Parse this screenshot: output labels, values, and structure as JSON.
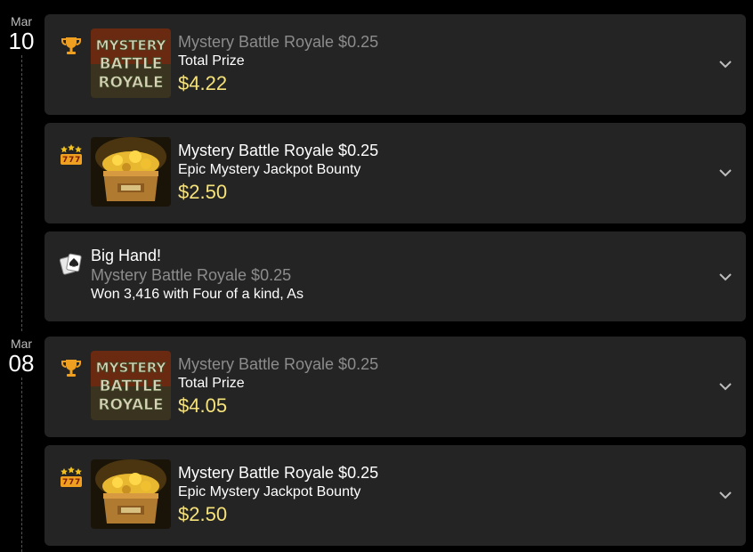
{
  "dates": [
    {
      "month": "Mar",
      "day": "10"
    },
    {
      "month": "Mar",
      "day": "08"
    }
  ],
  "cards": [
    {
      "type": "tournament",
      "icon": "trophy-icon",
      "thumb": "mystery-battle-royale-logo",
      "title": "Mystery Battle Royale $0.25",
      "subtitle": "Total Prize",
      "amount": "$4.22",
      "logo_text": [
        "MYSTERY",
        "BATTLE",
        "ROYALE"
      ]
    },
    {
      "type": "jackpot",
      "icon": "slot-777-icon",
      "thumb": "gold-treasure-chest",
      "title": "Mystery Battle Royale $0.25",
      "subtitle": "Epic Mystery Jackpot Bounty",
      "amount": "$2.50"
    },
    {
      "type": "bighand",
      "icon": "playing-cards-icon",
      "title": "Big Hand!",
      "subtitle": "Mystery Battle Royale $0.25",
      "detail": "Won 3,416 with Four of a kind, As"
    },
    {
      "type": "tournament",
      "icon": "trophy-icon",
      "thumb": "mystery-battle-royale-logo",
      "title": "Mystery Battle Royale $0.25",
      "subtitle": "Total Prize",
      "amount": "$4.05",
      "logo_text": [
        "MYSTERY",
        "BATTLE",
        "ROYALE"
      ]
    },
    {
      "type": "jackpot",
      "icon": "slot-777-icon",
      "thumb": "gold-treasure-chest",
      "title": "Mystery Battle Royale $0.25",
      "subtitle": "Epic Mystery Jackpot Bounty",
      "amount": "$2.50"
    }
  ],
  "colors": {
    "background": "#000000",
    "card": "#242424",
    "muted_text": "#8c8c8c",
    "amount": "#f6e27a",
    "trophy": "#f0a020"
  }
}
